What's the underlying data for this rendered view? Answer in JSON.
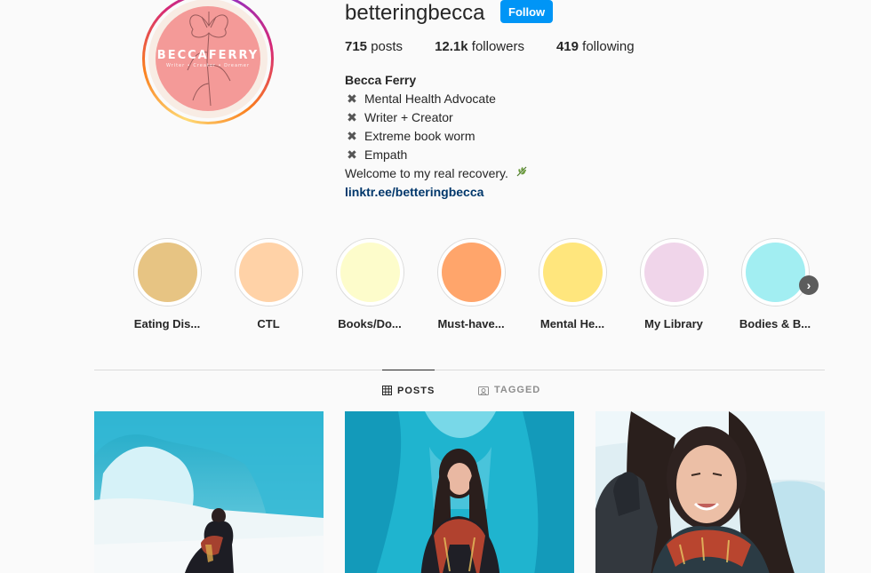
{
  "profile": {
    "username": "betteringbecca",
    "follow_label": "Follow",
    "avatar": {
      "brand": "BECCAFERRY",
      "tagline": "Writer • Creator • Dreamer"
    },
    "stats": [
      {
        "count": "715",
        "label": "posts"
      },
      {
        "count": "12.1k",
        "label": "followers"
      },
      {
        "count": "419",
        "label": "following"
      }
    ],
    "bio": {
      "full_name": "Becca Ferry",
      "lines": [
        "Mental Health Advocate",
        "Writer + Creator",
        "Extreme book worm",
        "Empath"
      ],
      "bullet_icon": "heavy-x-icon",
      "welcome": "Welcome to my real recovery.",
      "welcome_icon": "herb-icon",
      "link": "linktr.ee/betteringbecca"
    }
  },
  "highlights": [
    {
      "label": "Eating Dis...",
      "color": "#e7c483"
    },
    {
      "label": "CTL",
      "color": "#ffd2a7"
    },
    {
      "label": "Books/Do...",
      "color": "#fdfccb"
    },
    {
      "label": "Must-have...",
      "color": "#ffa56b"
    },
    {
      "label": "Mental He...",
      "color": "#ffe67d"
    },
    {
      "label": "My Library",
      "color": "#f0d5ea"
    },
    {
      "label": "Bodies & B...",
      "color": "#a2eef2"
    }
  ],
  "highlights_next_icon": "chevron-right-icon",
  "tabs": [
    {
      "label": "POSTS",
      "icon": "grid-icon",
      "active": true
    },
    {
      "label": "TAGGED",
      "icon": "tag-icon",
      "active": false
    }
  ],
  "posts_count_visible": 3,
  "colors": {
    "accent": "#0095f6",
    "link": "#00376b",
    "text": "#262626",
    "muted": "#8e8e8e",
    "background": "#fafafa"
  }
}
